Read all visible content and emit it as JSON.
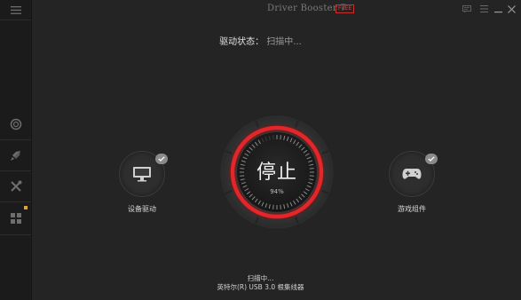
{
  "titlebar": {
    "app_title": "Driver Booster 7",
    "free_badge": "FREE"
  },
  "status": {
    "label": "驱动状态：",
    "value": "扫描中..."
  },
  "left_feature": {
    "label": "设备驱动",
    "icon": "monitor-icon"
  },
  "right_feature": {
    "label": "游戏组件",
    "icon": "gamepad-icon"
  },
  "scan_button": {
    "label": "停止",
    "percent": "94%",
    "progress": 0.94
  },
  "scan_info": {
    "line1": "扫描中...",
    "line2": "英特尔(R) USB 3.0 根集线器"
  },
  "colors": {
    "accent": "#e2262a",
    "background": "#242424",
    "sidebar": "#1b1b1b"
  },
  "sidebar": {
    "items": [
      {
        "icon": "menu-icon"
      },
      {
        "icon": "lifebuoy-icon"
      },
      {
        "icon": "rocket-icon"
      },
      {
        "icon": "tools-icon"
      },
      {
        "icon": "grid-icon"
      }
    ]
  }
}
